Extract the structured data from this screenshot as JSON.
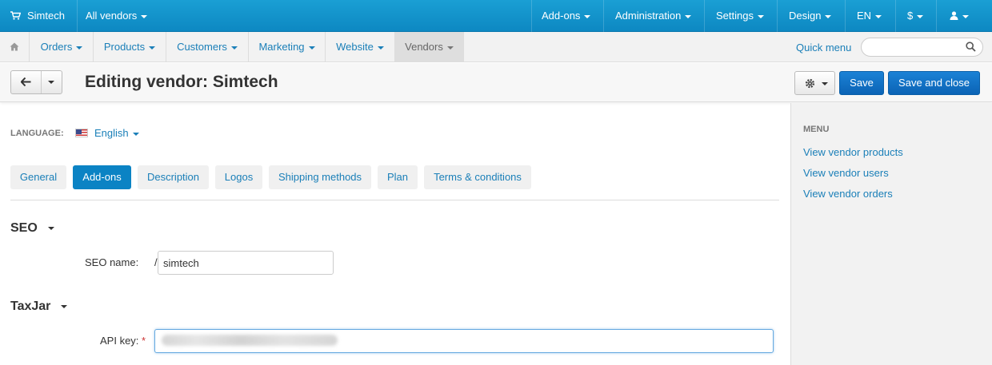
{
  "topbar": {
    "store_name": "Simtech",
    "vendor_selector": "All vendors",
    "menus": [
      "Add-ons",
      "Administration",
      "Settings",
      "Design",
      "EN",
      "$"
    ]
  },
  "nav": {
    "tabs": [
      "Orders",
      "Products",
      "Customers",
      "Marketing",
      "Website",
      "Vendors"
    ],
    "active_tab": "Vendors",
    "quick_menu": "Quick menu",
    "search_placeholder": ""
  },
  "titlebar": {
    "title": "Editing vendor: Simtech",
    "save_label": "Save",
    "save_close_label": "Save and close"
  },
  "sidebar": {
    "heading": "MENU",
    "links": [
      "View vendor products",
      "View vendor users",
      "View vendor orders"
    ]
  },
  "language": {
    "label": "LANGUAGE:",
    "value": "English"
  },
  "tabs": [
    "General",
    "Add-ons",
    "Description",
    "Logos",
    "Shipping methods",
    "Plan",
    "Terms & conditions"
  ],
  "active_tab": "Add-ons",
  "seo": {
    "title": "SEO",
    "name_label": "SEO name:",
    "prefix": "/",
    "name_value": "simtech"
  },
  "taxjar": {
    "title": "TaxJar",
    "api_label": "API key:",
    "required_mark": "*",
    "api_value": ""
  },
  "colors": {
    "topbar": "#0d88c2",
    "link": "#1a7fb8",
    "primary_button": "#0b63b5",
    "active_tab": "#0b83c4"
  }
}
